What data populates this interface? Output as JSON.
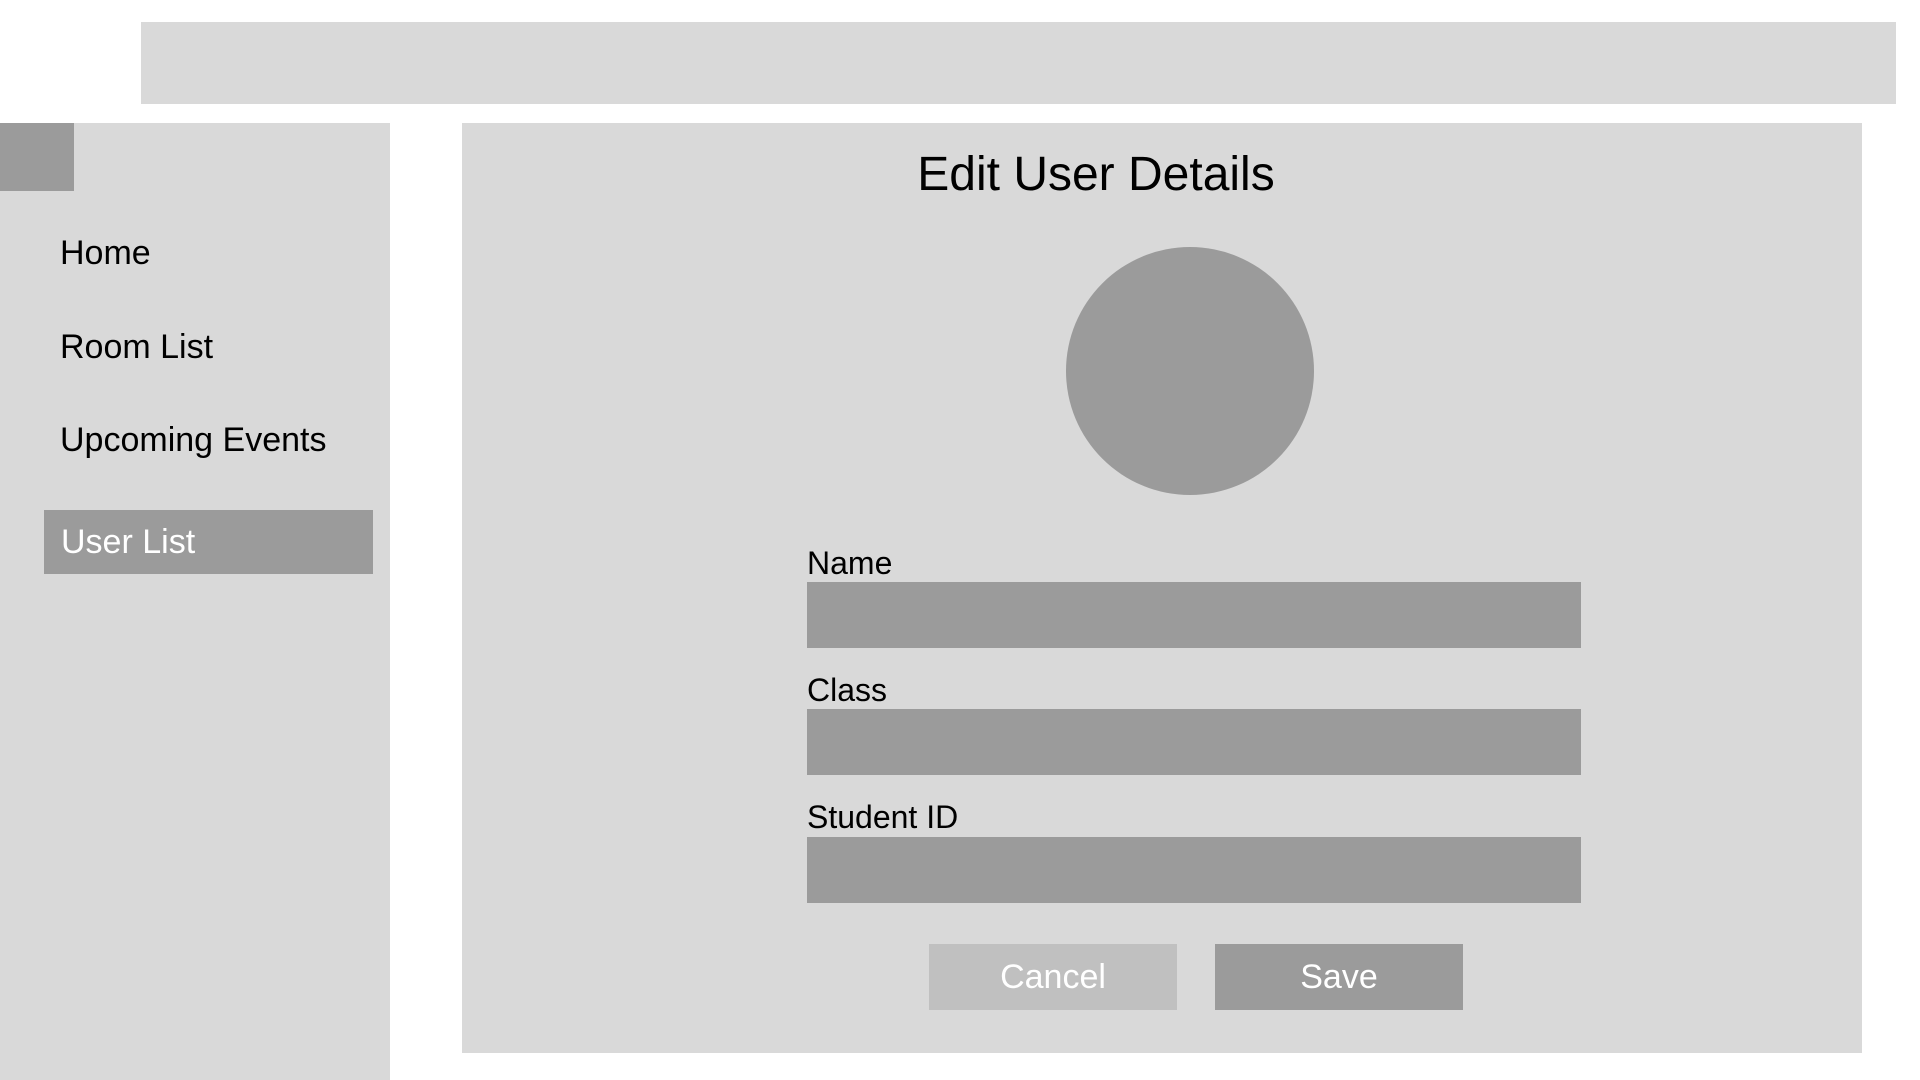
{
  "sidebar": {
    "items": [
      {
        "label": "Home"
      },
      {
        "label": "Room List"
      },
      {
        "label": "Upcoming Events"
      },
      {
        "label": "User List",
        "active": true
      }
    ]
  },
  "main": {
    "title": "Edit User Details",
    "form": {
      "fields": [
        {
          "label": "Name",
          "value": "",
          "placeholder": ""
        },
        {
          "label": "Class",
          "value": "",
          "placeholder": ""
        },
        {
          "label": "Student ID",
          "value": "",
          "placeholder": ""
        }
      ],
      "cancel_label": "Cancel",
      "save_label": "Save"
    }
  },
  "colors": {
    "panel_background": "#d9d9d9",
    "placeholder_fill": "#9b9b9b",
    "active_nav_background": "#9b9b9b",
    "cancel_button": "#c0c0c0",
    "save_button": "#9b9b9b",
    "button_text": "#ffffff"
  }
}
